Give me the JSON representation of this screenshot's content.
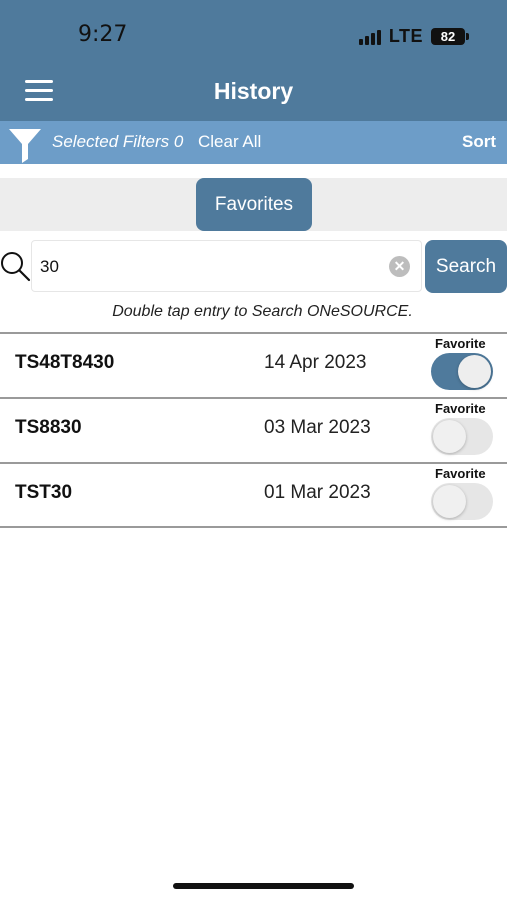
{
  "status_bar": {
    "time": "9:27",
    "network": "LTE",
    "battery": "82"
  },
  "header": {
    "title": "History",
    "menu_icon": "hamburger-menu-icon"
  },
  "filter_bar": {
    "filter_icon": "funnel-icon",
    "selected_filters_label": "Selected Filters 0",
    "clear_all_label": "Clear All",
    "sort_label": "Sort"
  },
  "favorites_button": {
    "label": "Favorites"
  },
  "search": {
    "value": "30",
    "button_label": "Search",
    "hint": "Double tap entry to Search ONeSOURCE."
  },
  "history": {
    "favorite_label": "Favorite",
    "items": [
      {
        "code": "TS48T8430",
        "date": "14 Apr 2023",
        "favorite": true
      },
      {
        "code": "TS8830",
        "date": "03 Mar 2023",
        "favorite": false
      },
      {
        "code": "TST30",
        "date": "01 Mar 2023",
        "favorite": false
      }
    ]
  },
  "colors": {
    "header": "#4f7a9c",
    "filter_bar": "#6d9dc8",
    "toggle_on": "#4f7a9c"
  }
}
